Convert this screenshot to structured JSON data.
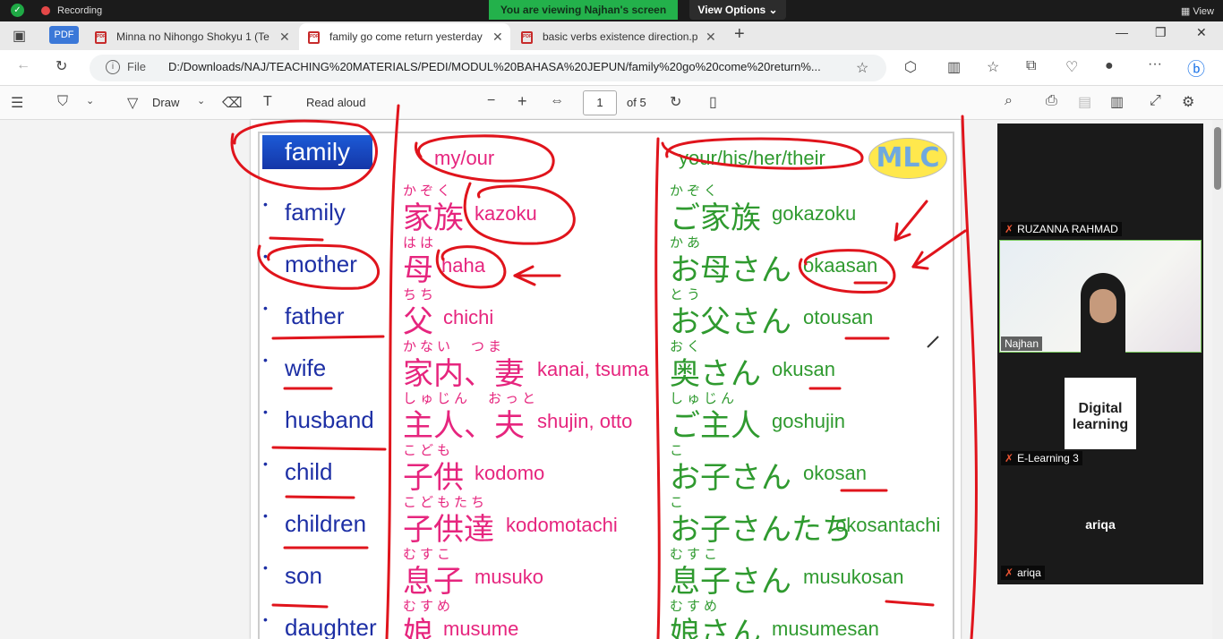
{
  "meeting": {
    "recording_label": "Recording",
    "viewing_banner": "You are viewing Najhan's screen",
    "view_options": "View Options ⌄",
    "view_button": "View"
  },
  "tabs": [
    {
      "label": "Minna no Nihongo Shokyu 1 (Te"
    },
    {
      "label": "family go come return yesterday"
    },
    {
      "label": "basic verbs existence direction.p"
    }
  ],
  "pdf_badge": "PDF",
  "address": {
    "file_label": "File",
    "url": "D:/Downloads/NAJ/TEACHING%20MATERIALS/PEDI/MODUL%20BAHASA%20JEPUN/family%20go%20come%20return%..."
  },
  "pdf_toolbar": {
    "draw_label": "Draw",
    "read_aloud": "Read aloud",
    "page_current": "1",
    "page_total": "of 5"
  },
  "document": {
    "header": "family",
    "my_our": "my/our",
    "your_etc": "your/his/her/their",
    "logo": "MLC",
    "rows": [
      {
        "en": "family",
        "hf": "かぞく",
        "hk": "家族",
        "hr": "kazoku",
        "gf": "かぞく",
        "gk": "ご家族",
        "gr": "gokazoku"
      },
      {
        "en": "mother",
        "hf": "はは",
        "hk": "母",
        "hr": "haha",
        "gf": "かあ",
        "gk": "お母さん",
        "gr": "okaasan"
      },
      {
        "en": "father",
        "hf": "ちち",
        "hk": "父",
        "hr": "chichi",
        "gf": "とう",
        "gk": "お父さん",
        "gr": "otousan"
      },
      {
        "en": "wife",
        "hf": "かない　つま",
        "hk": "家内、妻",
        "hr": "kanai, tsuma",
        "gf": "おく",
        "gk": "奥さん",
        "gr": "okusan"
      },
      {
        "en": "husband",
        "hf": "しゅじん　おっと",
        "hk": "主人、夫",
        "hr": "shujin, otto",
        "gf": "しゅじん",
        "gk": "ご主人",
        "gr": "goshujin"
      },
      {
        "en": "child",
        "hf": "こども",
        "hk": "子供",
        "hr": "kodomo",
        "gf": "こ",
        "gk": "お子さん",
        "gr": "okosan"
      },
      {
        "en": "children",
        "hf": "こどもたち",
        "hk": "子供達",
        "hr": "kodomotachi",
        "gf": "こ",
        "gk": "お子さんたち",
        "gr": "okosantachi"
      },
      {
        "en": "son",
        "hf": "むすこ",
        "hk": "息子",
        "hr": "musuko",
        "gf": "むすこ",
        "gk": "息子さん",
        "gr": "musukosan"
      },
      {
        "en": "daughter",
        "hf": "むすめ",
        "hk": "娘",
        "hr": "musume",
        "gf": "むすめ",
        "gk": "娘さん",
        "gr": "musumesan"
      }
    ]
  },
  "participants": [
    {
      "name": "RUZANNA RAHMAD"
    },
    {
      "name": "Najhan"
    },
    {
      "name": "E-Learning 3",
      "logo": "Digital learning"
    },
    {
      "name": "ariqa",
      "center": "ariqa"
    }
  ]
}
